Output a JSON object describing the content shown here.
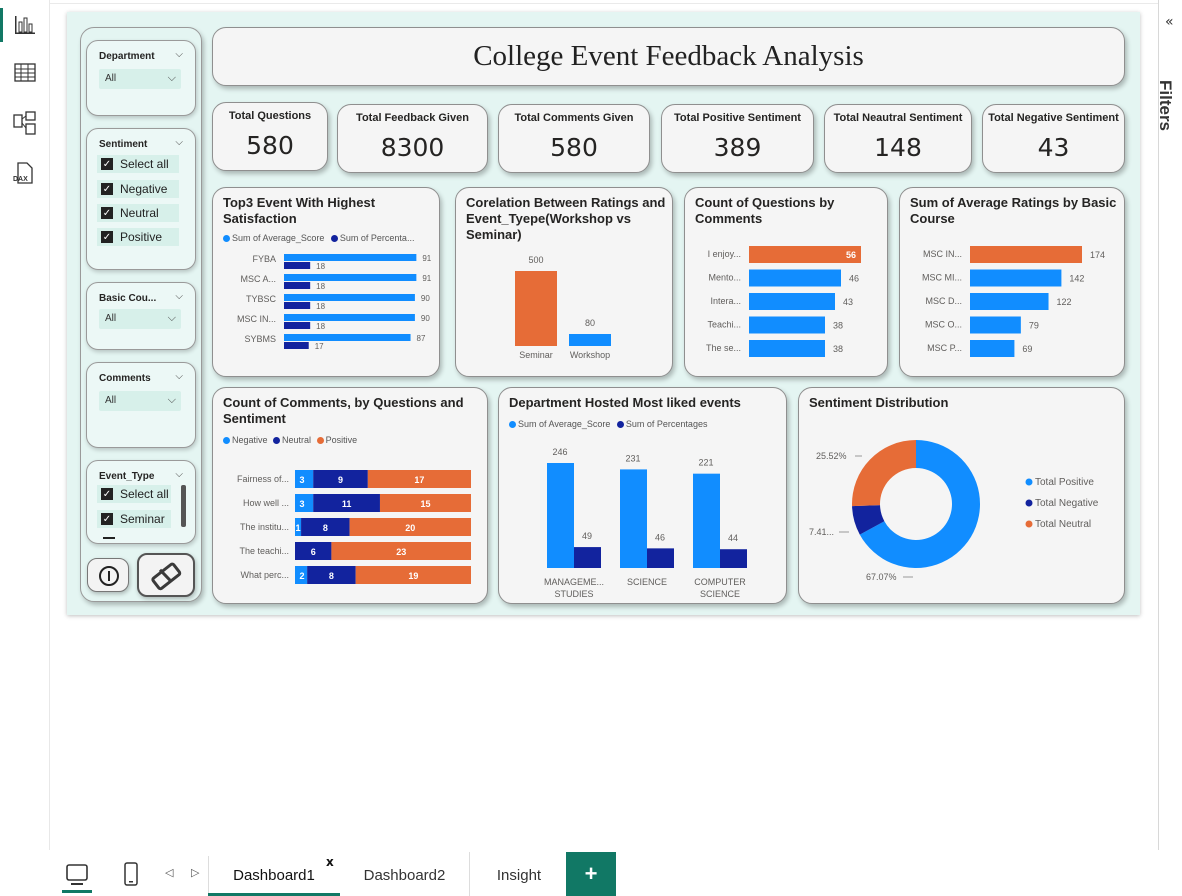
{
  "app": {
    "filters_label": "Filters",
    "collapse_glyph": "«",
    "nav_icons": [
      "report-view-icon",
      "table-view-icon",
      "model-view-icon",
      "dax-query-view-icon"
    ],
    "dax_label": "DAX"
  },
  "dashboard": {
    "title": "College Event Feedback Analysis",
    "kpis": [
      {
        "label": "Total Questions",
        "value": "580"
      },
      {
        "label": "Total Feedback Given",
        "value": "8300"
      },
      {
        "label": "Total Comments Given",
        "value": "580"
      },
      {
        "label": "Total Positive Sentiment",
        "value": "389"
      },
      {
        "label": "Total Neautral Sentiment",
        "value": "148"
      },
      {
        "label": "Total Negative Sentiment",
        "value": "43"
      }
    ]
  },
  "slicers": {
    "department": {
      "title": "Department",
      "value": "All"
    },
    "sentiment": {
      "title": "Sentiment",
      "options": [
        "Select all",
        "Negative",
        "Neutral",
        "Positive"
      ]
    },
    "basic_course": {
      "title": "Basic Cou...",
      "value": "All"
    },
    "comments": {
      "title": "Comments",
      "value": "All"
    },
    "event_type": {
      "title": "Event_Type",
      "options": [
        "Select all",
        "Seminar"
      ]
    }
  },
  "colors": {
    "blue": "#118DFF",
    "navy": "#12239E",
    "orange": "#E66C37",
    "teal": "#117865",
    "canvas_bg": "#E4F5F2"
  },
  "chart_data": [
    {
      "type": "bar",
      "orientation": "horizontal",
      "title": "Top3 Event With Highest Satisfaction",
      "categories": [
        "FYBA",
        "MSC A...",
        "TYBSC",
        "MSC IN...",
        "SYBMS"
      ],
      "series": [
        {
          "name": "Sum of Average_Score",
          "values": [
            91,
            91,
            90,
            90,
            87
          ]
        },
        {
          "name": "Sum of Percenta...",
          "values": [
            18,
            18,
            18,
            18,
            17
          ]
        }
      ]
    },
    {
      "type": "bar",
      "title": "Corelation Between Ratings and Event_Tyepe(Workshop vs Seminar)",
      "categories": [
        "Seminar",
        "Workshop"
      ],
      "values": [
        500,
        80
      ]
    },
    {
      "type": "bar",
      "orientation": "horizontal",
      "title": "Count of Questions by Comments",
      "categories": [
        "I enjoy...",
        "Mento...",
        "Intera...",
        "Teachi...",
        "The se..."
      ],
      "values": [
        56,
        46,
        43,
        38,
        38
      ]
    },
    {
      "type": "bar",
      "orientation": "horizontal",
      "title": "Sum of Average Ratings by Basic Course",
      "categories": [
        "MSC IN...",
        "MSC MI...",
        "MSC D...",
        "MSC O...",
        "MSC P..."
      ],
      "values": [
        174,
        142,
        122,
        79,
        69
      ]
    },
    {
      "type": "bar",
      "orientation": "horizontal",
      "stacked": true,
      "title": "Count of Comments, by Questions and Sentiment",
      "categories": [
        "Fairness of...",
        "How well ...",
        "The institu...",
        "The teachi...",
        "What perc..."
      ],
      "series": [
        {
          "name": "Negative",
          "values": [
            3,
            3,
            1,
            0,
            2
          ]
        },
        {
          "name": "Neutral",
          "values": [
            9,
            11,
            8,
            6,
            8
          ]
        },
        {
          "name": "Positive",
          "values": [
            17,
            15,
            20,
            23,
            19
          ]
        }
      ]
    },
    {
      "type": "bar",
      "title": "Department Hosted Most liked events",
      "categories": [
        "MANAGEME... STUDIES",
        "SCIENCE",
        "COMPUTER SCIENCE"
      ],
      "series": [
        {
          "name": "Sum of Average_Score",
          "values": [
            246,
            231,
            221
          ]
        },
        {
          "name": "Sum of Percentages",
          "values": [
            49,
            46,
            44
          ]
        }
      ]
    },
    {
      "type": "pie",
      "donut": true,
      "title": "Sentiment Distribution",
      "slices": [
        {
          "name": "Total Positive",
          "value": 67.07,
          "label": "67.07%"
        },
        {
          "name": "Total Negative",
          "value": 7.41,
          "label": "7.41..."
        },
        {
          "name": "Total Neutral",
          "value": 25.52,
          "label": "25.52%"
        }
      ]
    }
  ],
  "tabs": {
    "items": [
      "Dashboard1",
      "Dashboard2",
      "Insight"
    ],
    "close_glyph": "x",
    "add_glyph": "+"
  }
}
